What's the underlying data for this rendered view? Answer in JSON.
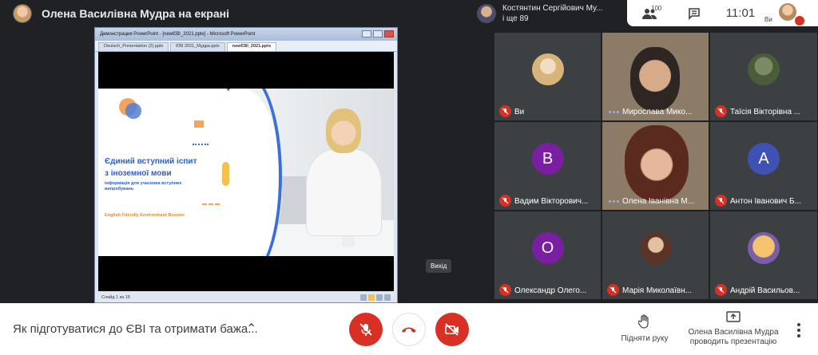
{
  "presenter": {
    "title": "Олена Василівна Мудра на екрані"
  },
  "shared_screen": {
    "window_title": "Демонстрация PowerPoint - [newЄВІ_2021.pptx] - Microsoft PowerPoint",
    "tabs": [
      "Deutsch_Presentation (2).pptx",
      "ЄВІ 2021_Мудра.pptx",
      "newЄВІ_2021.pptx"
    ],
    "slide": {
      "title_line1": "Єдиний вступний іспит",
      "title_line2": "з іноземної мови",
      "subtitle": "інформація для учасника вступних випробувань",
      "footer": "English Friendly Environment Booster"
    },
    "status": "Слайд 1 из 15"
  },
  "tooltip": "Вихід",
  "top_participant": {
    "name": "Костянтин Сергійович Му...",
    "more": "і ще 89"
  },
  "top_controls": {
    "people_count": "100",
    "time": "11:01",
    "self_label": "Ви"
  },
  "tiles": [
    {
      "name": "Ви",
      "type": "photo",
      "muted": true
    },
    {
      "name": "Мирослава Мико...",
      "type": "video",
      "muted": false
    },
    {
      "name": "Таїсія Вікторівна ...",
      "type": "photo",
      "muted": true
    },
    {
      "name": "Вадим Вікторович...",
      "type": "letter",
      "letter": "В",
      "color": "#7b1fa2",
      "muted": true
    },
    {
      "name": "Олена Іванівна М...",
      "type": "video",
      "muted": false
    },
    {
      "name": "Антон Іванович Б...",
      "type": "letter",
      "letter": "А",
      "color": "#3f51b5",
      "muted": true
    },
    {
      "name": "Олександр Олего...",
      "type": "letter",
      "letter": "О",
      "color": "#7b1fa2",
      "muted": true
    },
    {
      "name": "Марія Миколаївн...",
      "type": "photo",
      "muted": true
    },
    {
      "name": "Андрій Васильов...",
      "type": "photo",
      "muted": true
    }
  ],
  "bottom": {
    "meeting_title": "Як підготуватися до ЄВІ та отримати бажа...",
    "raise_hand": "Підняти руку",
    "presenting_line1": "Олена Василівна Мудра",
    "presenting_line2": "проводить презентацію"
  },
  "colors": {
    "danger": "#d93025",
    "dark_bg": "#202124",
    "tile_bg": "#3c4043",
    "slide_blue": "#2d5fc9"
  }
}
